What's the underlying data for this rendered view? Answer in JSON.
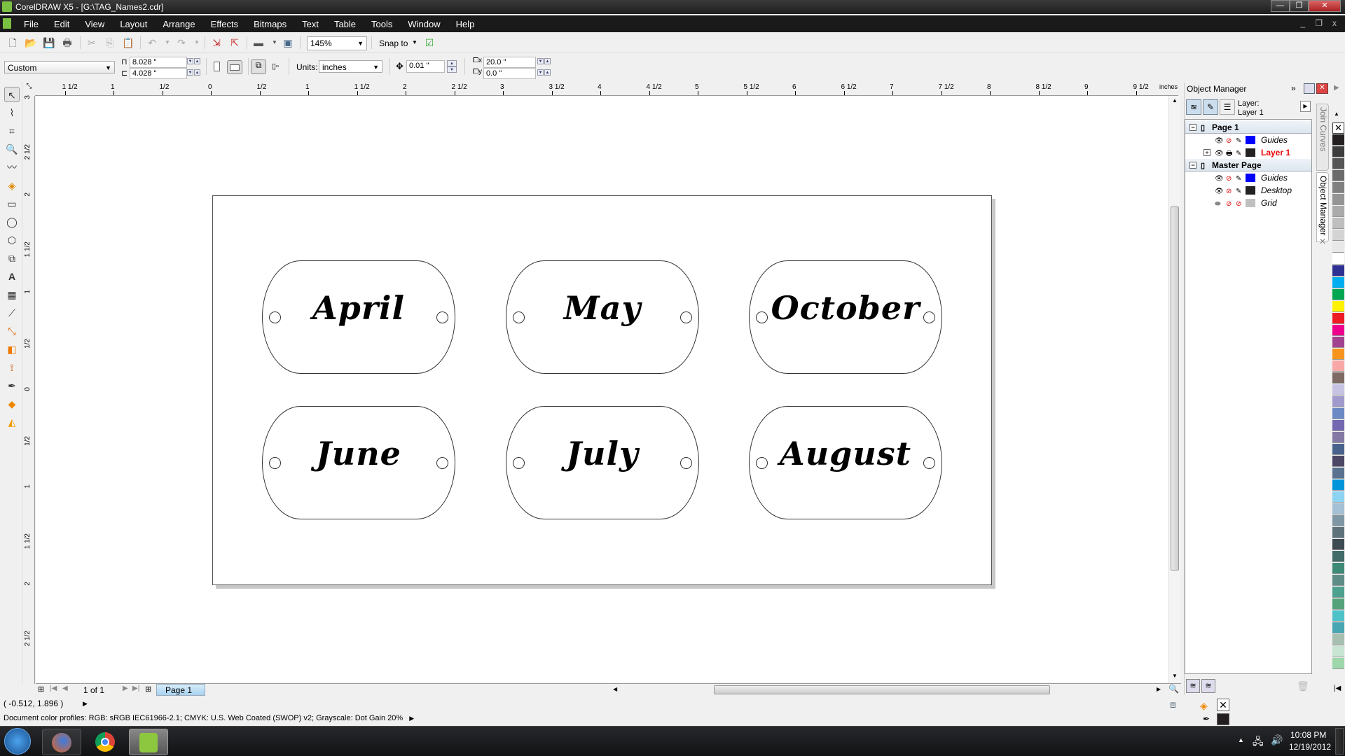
{
  "window": {
    "title": "CorelDRAW X5 - [G:\\TAG_Names2.cdr]",
    "controls": {
      "minimize": "—",
      "restore": "❐",
      "close": "✕"
    }
  },
  "menu": {
    "items": [
      "File",
      "Edit",
      "View",
      "Layout",
      "Arrange",
      "Effects",
      "Bitmaps",
      "Text",
      "Table",
      "Tools",
      "Window",
      "Help"
    ],
    "doc_controls": {
      "minimize": "_",
      "restore": "❐",
      "close": "x"
    }
  },
  "standard_toolbar": {
    "icons": [
      "new-document-icon",
      "open-icon",
      "save-icon",
      "print-icon",
      "cut-icon",
      "copy-icon",
      "paste-icon",
      "undo-icon",
      "redo-icon",
      "import-icon",
      "export-icon",
      "application-launcher-icon",
      "welcome-screen-icon"
    ],
    "zoom_level": "145%",
    "snap_to_label": "Snap to",
    "options_icon": "options-icon"
  },
  "property_bar": {
    "page_preset": "Custom",
    "page_width": "8.028 \"",
    "page_height": "4.028 \"",
    "units_label": "Units:",
    "units_value": "inches",
    "nudge_distance": "0.01 \"",
    "duplicate_x": "20.0 \"",
    "duplicate_y": "0.0 \""
  },
  "toolbox": {
    "tools": [
      "pick-tool",
      "shape-tool",
      "crop-tool",
      "zoom-tool",
      "freehand-tool",
      "smart-fill-tool",
      "rectangle-tool",
      "ellipse-tool",
      "polygon-tool",
      "basic-shapes-tool",
      "text-tool",
      "table-tool",
      "dimension-tool",
      "connector-tool",
      "blend-tool",
      "eyedropper-tool",
      "outline-tool",
      "fill-tool",
      "interactive-fill-tool"
    ]
  },
  "rulers": {
    "units": "inches",
    "horizontal_labels": [
      "1 1/2",
      "1",
      "1/2",
      "0",
      "1/2",
      "1",
      "1 1/2",
      "2",
      "2 1/2",
      "3",
      "3 1/2",
      "4",
      "4 1/2",
      "5",
      "5 1/2",
      "6",
      "6 1/2",
      "7",
      "7 1/2",
      "8",
      "8 1/2",
      "9",
      "9 1/2"
    ],
    "vertical_labels": [
      "3",
      "2 1/2",
      "2",
      "1 1/2",
      "1",
      "1/2",
      "0",
      "1/2",
      "1",
      "1 1/2",
      "2",
      "2 1/2"
    ]
  },
  "document": {
    "tags": [
      {
        "name": "April"
      },
      {
        "name": "May"
      },
      {
        "name": "October"
      },
      {
        "name": "June"
      },
      {
        "name": "July"
      },
      {
        "name": "August"
      }
    ]
  },
  "page_navigator": {
    "page_count": "1 of 1",
    "tab_label": "Page 1"
  },
  "status": {
    "cursor_coords": "( -0.512, 1.896 )",
    "color_profiles": "Document color profiles: RGB: sRGB IEC61966-2.1; CMYK: U.S. Web Coated (SWOP) v2; Grayscale: Dot Gain 20%"
  },
  "object_manager": {
    "title": "Object Manager",
    "layer_label": "Layer:",
    "current_layer": "Layer 1",
    "tree": [
      {
        "type": "page",
        "label": "Page 1",
        "expanded": true,
        "children": [
          {
            "label": "Guides",
            "color": "#0000ff",
            "active": false
          },
          {
            "label": "Layer 1",
            "color": "#222222",
            "active": true
          }
        ]
      },
      {
        "type": "page",
        "label": "Master Page",
        "expanded": true,
        "children": [
          {
            "label": "Guides",
            "color": "#0000ff"
          },
          {
            "label": "Desktop",
            "color": "#222222"
          },
          {
            "label": "Grid",
            "color": "#c0c0c0"
          }
        ]
      }
    ],
    "side_tabs": [
      "Join Curves",
      "Object Manager"
    ]
  },
  "color_palette": [
    "none",
    "#231f20",
    "#3d3d3d",
    "#555555",
    "#6b6b6b",
    "#808080",
    "#959595",
    "#aaaaaa",
    "#bfbfbf",
    "#d4d4d4",
    "#e8e8e8",
    "#ffffff",
    "#2e3192",
    "#00aeef",
    "#00a651",
    "#fff200",
    "#ed1c24",
    "#ec008c",
    "#a3428f",
    "#f7941d",
    "#f9a8a8",
    "#7d6a63",
    "#c6c3e2",
    "#a09bcc",
    "#6b89c5",
    "#7468b0",
    "#8479a5",
    "#48628c",
    "#4d4766",
    "#5a7190",
    "#0095da",
    "#8dd3f3",
    "#a3c0d4",
    "#7f97a4",
    "#5e727c",
    "#3d4a51",
    "#416b68",
    "#3d8a76",
    "#5e8c86",
    "#4ea08f",
    "#53a27a",
    "#4fc2c9",
    "#47a6b1",
    "#a7bfb0",
    "#c8e4d3",
    "#9ed7a9"
  ],
  "fill_outline": {
    "fill": "none",
    "outline": "#231f20"
  },
  "taskbar": {
    "apps": [
      "start-button",
      "firefox",
      "chrome",
      "coreldraw"
    ],
    "time": "10:08 PM",
    "date": "12/19/2012"
  }
}
